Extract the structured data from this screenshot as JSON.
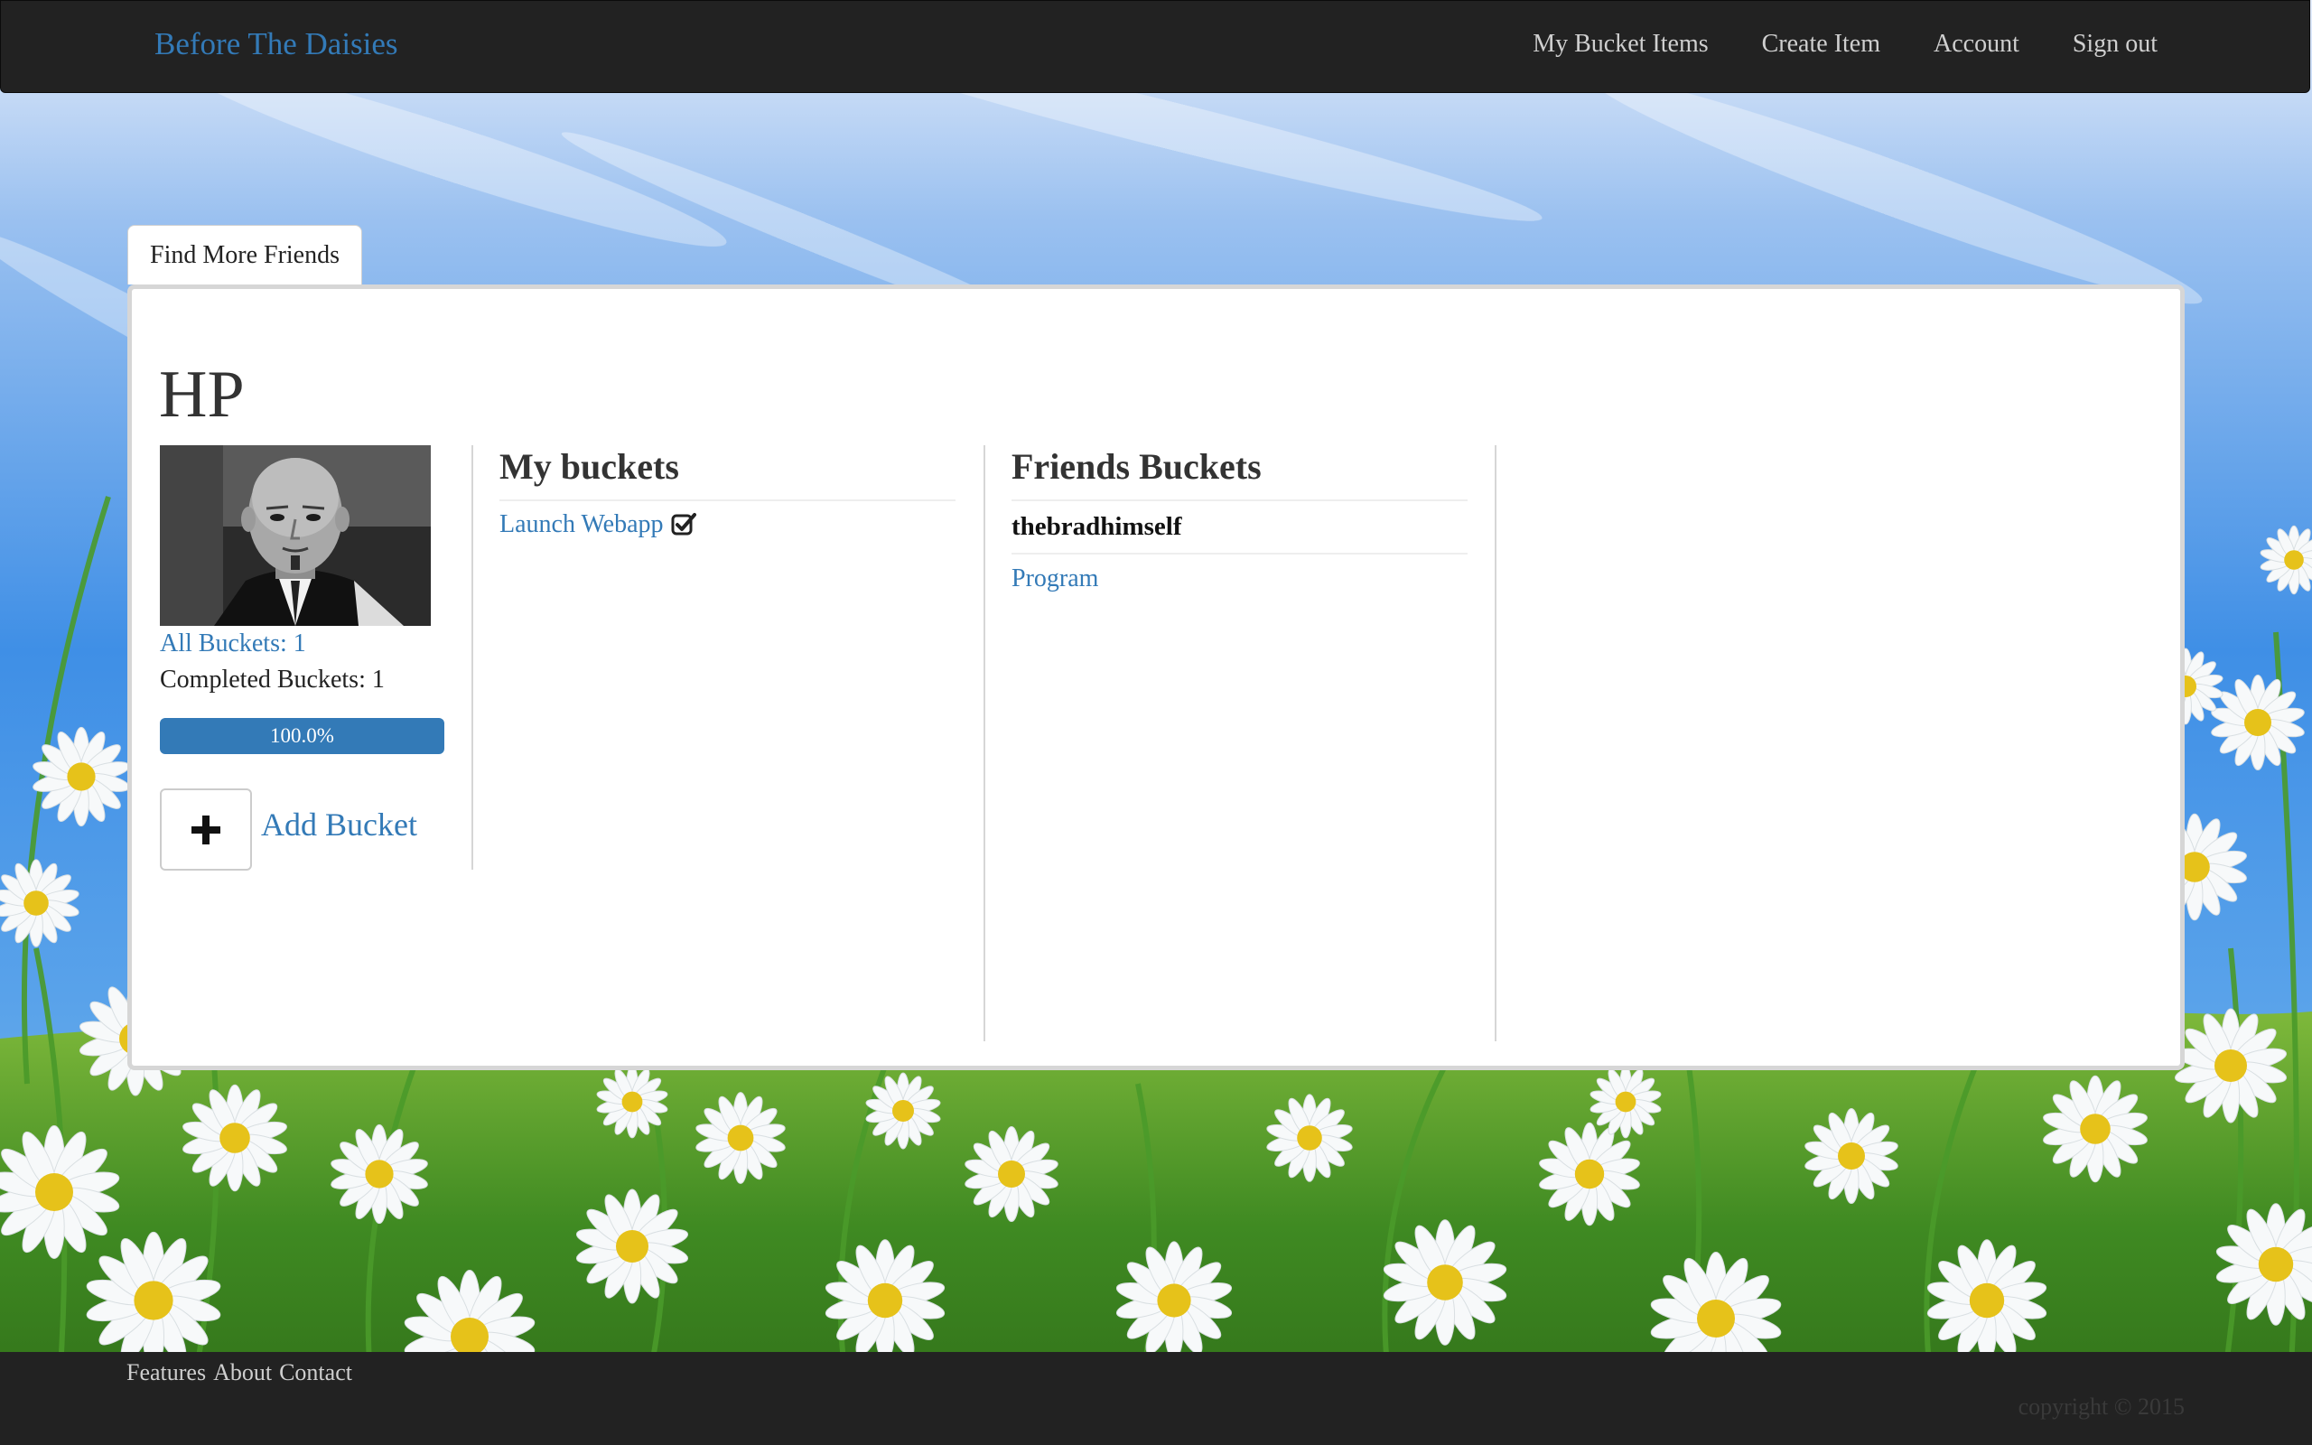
{
  "navbar": {
    "brand": "Before The Daisies",
    "links": [
      "My Bucket Items",
      "Create Item",
      "Account",
      "Sign out"
    ]
  },
  "tab": {
    "find_friends_label": "Find More Friends"
  },
  "profile": {
    "name": "HP",
    "all_buckets_label": "All Buckets: 1",
    "completed_buckets_label": "Completed Buckets: 1",
    "progress_label": "100.0%",
    "progress_value": 1.0,
    "add_bucket_label": "Add Bucket"
  },
  "my_buckets": {
    "heading": "My buckets",
    "items": [
      {
        "label": "Launch Webapp",
        "completed": true
      }
    ]
  },
  "friends_buckets": {
    "heading": "Friends Buckets",
    "friends": [
      {
        "name": "thebradhimself",
        "items": [
          "Program"
        ]
      }
    ]
  },
  "footer": {
    "links": [
      "Features",
      "About",
      "Contact"
    ],
    "copyright": "copyright © 2015"
  },
  "colors": {
    "link": "#337ab7",
    "navbar": "#222222",
    "progress": "#337ab7"
  },
  "icons": {
    "completed": "check-square-icon",
    "add": "plus-icon"
  }
}
